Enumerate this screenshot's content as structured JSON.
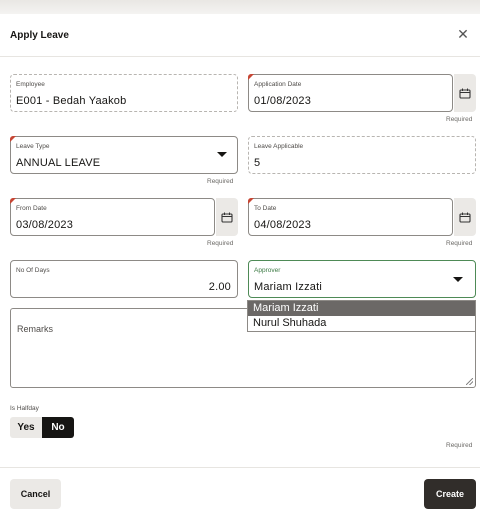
{
  "dialog": {
    "title": "Apply Leave",
    "close_icon": "close-icon"
  },
  "fields": {
    "employee": {
      "label": "Employee",
      "value": "E001 - Bedah Yaakob"
    },
    "application_date": {
      "label": "Application Date",
      "value": "01/08/2023",
      "required_text": "Required"
    },
    "leave_type": {
      "label": "Leave Type",
      "value": "ANNUAL LEAVE",
      "required_text": "Required"
    },
    "leave_applicable": {
      "label": "Leave Applicable",
      "value": "5"
    },
    "from_date": {
      "label": "From Date",
      "value": "03/08/2023",
      "required_text": "Required"
    },
    "to_date": {
      "label": "To Date",
      "value": "04/08/2023",
      "required_text": "Required"
    },
    "no_of_days": {
      "label": "No Of Days",
      "value": "2.00"
    },
    "approver": {
      "label": "Approver",
      "value": "Mariam Izzati",
      "options": [
        "Mariam Izzati",
        "Nurul Shuhada"
      ]
    },
    "remarks": {
      "label": "Remarks",
      "value": ""
    },
    "is_halfday": {
      "label": "Is Halfday",
      "options": [
        "Yes",
        "No"
      ],
      "selected": "No",
      "required_text": "Required"
    }
  },
  "footer": {
    "cancel_label": "Cancel",
    "create_label": "Create"
  },
  "colors": {
    "required_marker": "#c74634",
    "selected_toggle": "#161513",
    "primary_button": "#312d2a",
    "approver_focus": "#4e8a56"
  }
}
